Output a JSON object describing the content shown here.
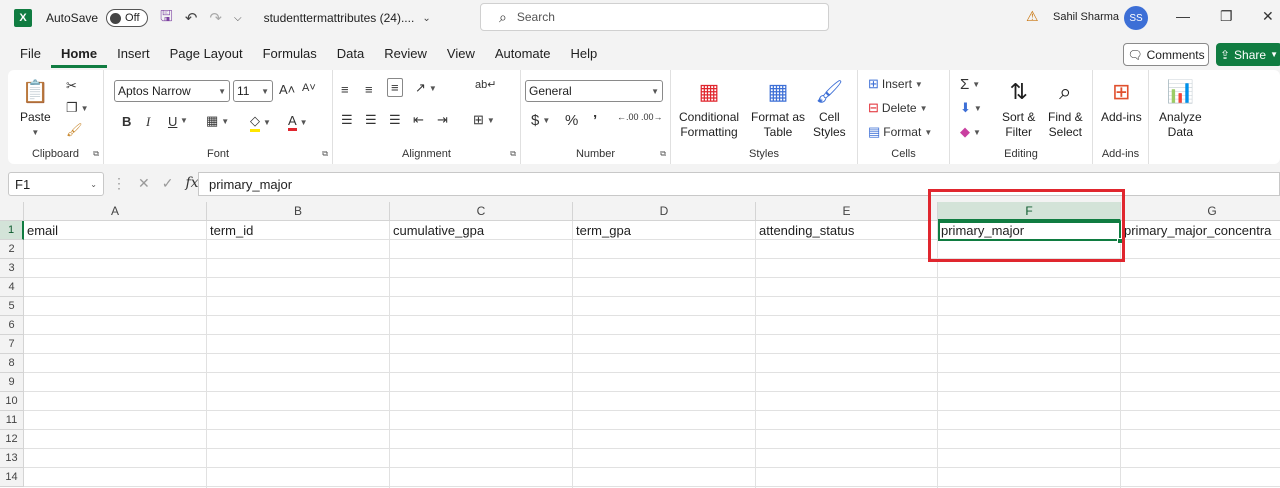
{
  "titlebar": {
    "autosave_label": "AutoSave",
    "autosave_state": "Off",
    "filename": "studenttermattributes (24)....",
    "search_placeholder": "Search",
    "user_name": "Sahil Sharma",
    "user_initials": "SS"
  },
  "menu": {
    "tabs": [
      "File",
      "Home",
      "Insert",
      "Page Layout",
      "Formulas",
      "Data",
      "Review",
      "View",
      "Automate",
      "Help"
    ],
    "active": "Home",
    "comments_label": "Comments",
    "share_label": "Share"
  },
  "ribbon": {
    "clipboard": {
      "label": "Clipboard",
      "paste": "Paste"
    },
    "font": {
      "label": "Font",
      "family": "Aptos Narrow",
      "size": "11",
      "bold": "B",
      "italic": "I",
      "underline": "U"
    },
    "alignment": {
      "label": "Alignment"
    },
    "number": {
      "label": "Number",
      "format": "General"
    },
    "styles": {
      "label": "Styles",
      "conditional_formatting": "Conditional\nFormatting",
      "format_as_table": "Format as\nTable",
      "cell_styles": "Cell\nStyles"
    },
    "cells": {
      "label": "Cells",
      "insert": "Insert",
      "delete": "Delete",
      "format": "Format"
    },
    "editing": {
      "label": "Editing",
      "sort_filter": "Sort &\nFilter",
      "find_select": "Find &\nSelect"
    },
    "addins": {
      "label": "Add-ins",
      "addins_btn": "Add-ins"
    },
    "analyze": {
      "analyze_data": "Analyze\nData"
    }
  },
  "formula_bar": {
    "name_box": "F1",
    "fx": "fx",
    "content": "primary_major"
  },
  "grid": {
    "columns": [
      "A",
      "B",
      "C",
      "D",
      "E",
      "F",
      "G"
    ],
    "selected_column": "F",
    "rows": [
      "1",
      "2",
      "3",
      "4",
      "5",
      "6",
      "7",
      "8",
      "9",
      "10",
      "11",
      "12",
      "13",
      "14"
    ],
    "row1": [
      "email",
      "term_id",
      "cumulative_gpa",
      "term_gpa",
      "attending_status",
      "primary_major",
      "primary_major_concentra"
    ]
  },
  "colors": {
    "excel_green": "#107c41",
    "highlight_red": "#e0262e"
  }
}
